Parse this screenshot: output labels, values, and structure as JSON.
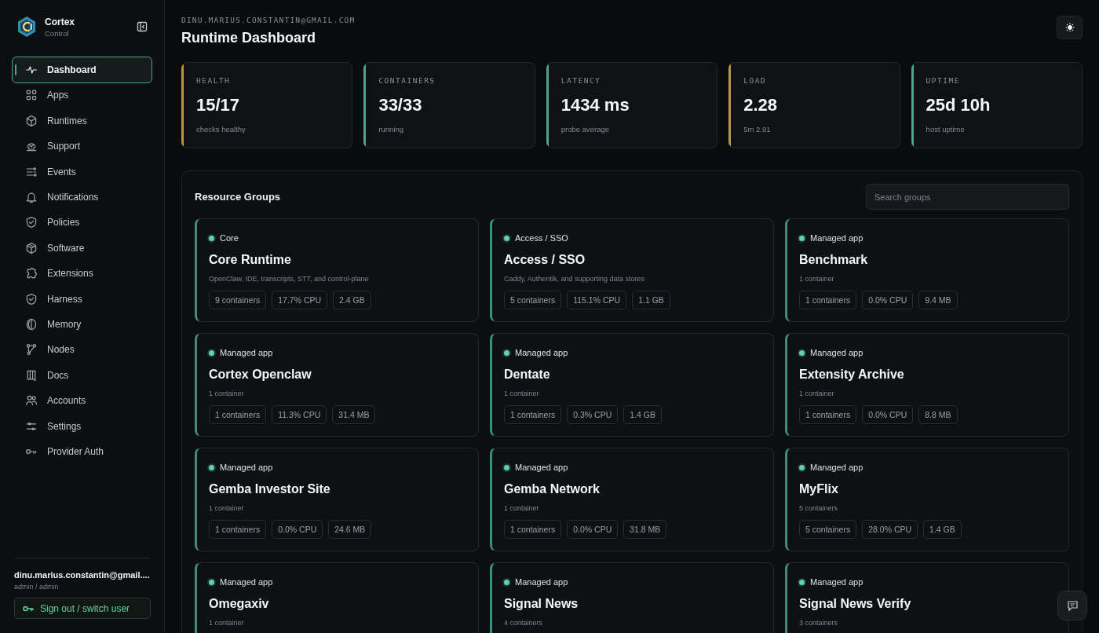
{
  "brand": {
    "name": "Cortex",
    "subtitle": "Control"
  },
  "nav": [
    {
      "label": "Dashboard",
      "selected": true
    },
    {
      "label": "Apps",
      "selected": false
    },
    {
      "label": "Runtimes",
      "selected": false
    },
    {
      "label": "Support",
      "selected": false
    },
    {
      "label": "Events",
      "selected": false
    },
    {
      "label": "Notifications",
      "selected": false
    },
    {
      "label": "Policies",
      "selected": false
    },
    {
      "label": "Software",
      "selected": false
    },
    {
      "label": "Extensions",
      "selected": false
    },
    {
      "label": "Harness",
      "selected": false
    },
    {
      "label": "Memory",
      "selected": false
    },
    {
      "label": "Nodes",
      "selected": false
    },
    {
      "label": "Docs",
      "selected": false
    },
    {
      "label": "Accounts",
      "selected": false
    },
    {
      "label": "Settings",
      "selected": false
    },
    {
      "label": "Provider Auth",
      "selected": false
    }
  ],
  "user": {
    "email": "dinu.marius.constantin@gmail....",
    "role": "admin / admin",
    "sign_out": "Sign out / switch user"
  },
  "header": {
    "eyebrow": "DINU.MARIUS.CONSTANTIN@GMAIL.COM",
    "title": "Runtime Dashboard"
  },
  "stats": [
    {
      "label": "HEALTH",
      "value": "15/17",
      "caption": "checks healthy",
      "color": "#b8964a"
    },
    {
      "label": "CONTAINERS",
      "value": "33/33",
      "caption": "running",
      "color": "#4fa58a"
    },
    {
      "label": "LATENCY",
      "value": "1434 ms",
      "caption": "probe average",
      "color": "#4fa58a"
    },
    {
      "label": "LOAD",
      "value": "2.28",
      "caption": "5m 2.91",
      "color": "#b8964a"
    },
    {
      "label": "UPTIME",
      "value": "25d 10h",
      "caption": "host uptime",
      "color": "#4fa58a"
    }
  ],
  "groups_panel": {
    "title": "Resource Groups",
    "search": {
      "placeholder": "Search groups"
    },
    "groups": [
      {
        "tag": "Core",
        "name": "Core Runtime",
        "description": "OpenClaw, IDE, transcripts, STT, and control-plane",
        "chips": [
          "9 containers",
          "17.7% CPU",
          "2.4 GB"
        ],
        "color": "#5fd3a4"
      },
      {
        "tag": "Access / SSO",
        "name": "Access / SSO",
        "description": "Caddy, Authentik, and supporting data stores",
        "chips": [
          "5 containers",
          "115.1% CPU",
          "1.1 GB"
        ],
        "color": "#5fd3a4"
      },
      {
        "tag": "Managed app",
        "name": "Benchmark",
        "description": "1 container",
        "chips": [
          "1 containers",
          "0.0% CPU",
          "9.4 MB"
        ],
        "color": "#5fd3a4"
      },
      {
        "tag": "Managed app",
        "name": "Cortex Openclaw",
        "description": "1 container",
        "chips": [
          "1 containers",
          "11.3% CPU",
          "31.4 MB"
        ],
        "color": "#5fd3a4"
      },
      {
        "tag": "Managed app",
        "name": "Dentate",
        "description": "1 container",
        "chips": [
          "1 containers",
          "0.3% CPU",
          "1.4 GB"
        ],
        "color": "#5fd3a4"
      },
      {
        "tag": "Managed app",
        "name": "Extensity Archive",
        "description": "1 container",
        "chips": [
          "1 containers",
          "0.0% CPU",
          "8.8 MB"
        ],
        "color": "#5fd3a4"
      },
      {
        "tag": "Managed app",
        "name": "Gemba Investor Site",
        "description": "1 container",
        "chips": [
          "1 containers",
          "0.0% CPU",
          "24.6 MB"
        ],
        "color": "#5fd3a4"
      },
      {
        "tag": "Managed app",
        "name": "Gemba Network",
        "description": "1 container",
        "chips": [
          "1 containers",
          "0.0% CPU",
          "31.8 MB"
        ],
        "color": "#5fd3a4"
      },
      {
        "tag": "Managed app",
        "name": "MyFlix",
        "description": "5 containers",
        "chips": [
          "5 containers",
          "28.0% CPU",
          "1.4 GB"
        ],
        "color": "#5fd3a4"
      },
      {
        "tag": "Managed app",
        "name": "Omegaxiv",
        "description": "1 container",
        "color": "#5fd3a4"
      },
      {
        "tag": "Managed app",
        "name": "Signal News",
        "description": "4 containers",
        "color": "#5fd3a4"
      },
      {
        "tag": "Managed app",
        "name": "Signal News Verify",
        "description": "3 containers",
        "color": "#5fd3a4"
      }
    ]
  }
}
